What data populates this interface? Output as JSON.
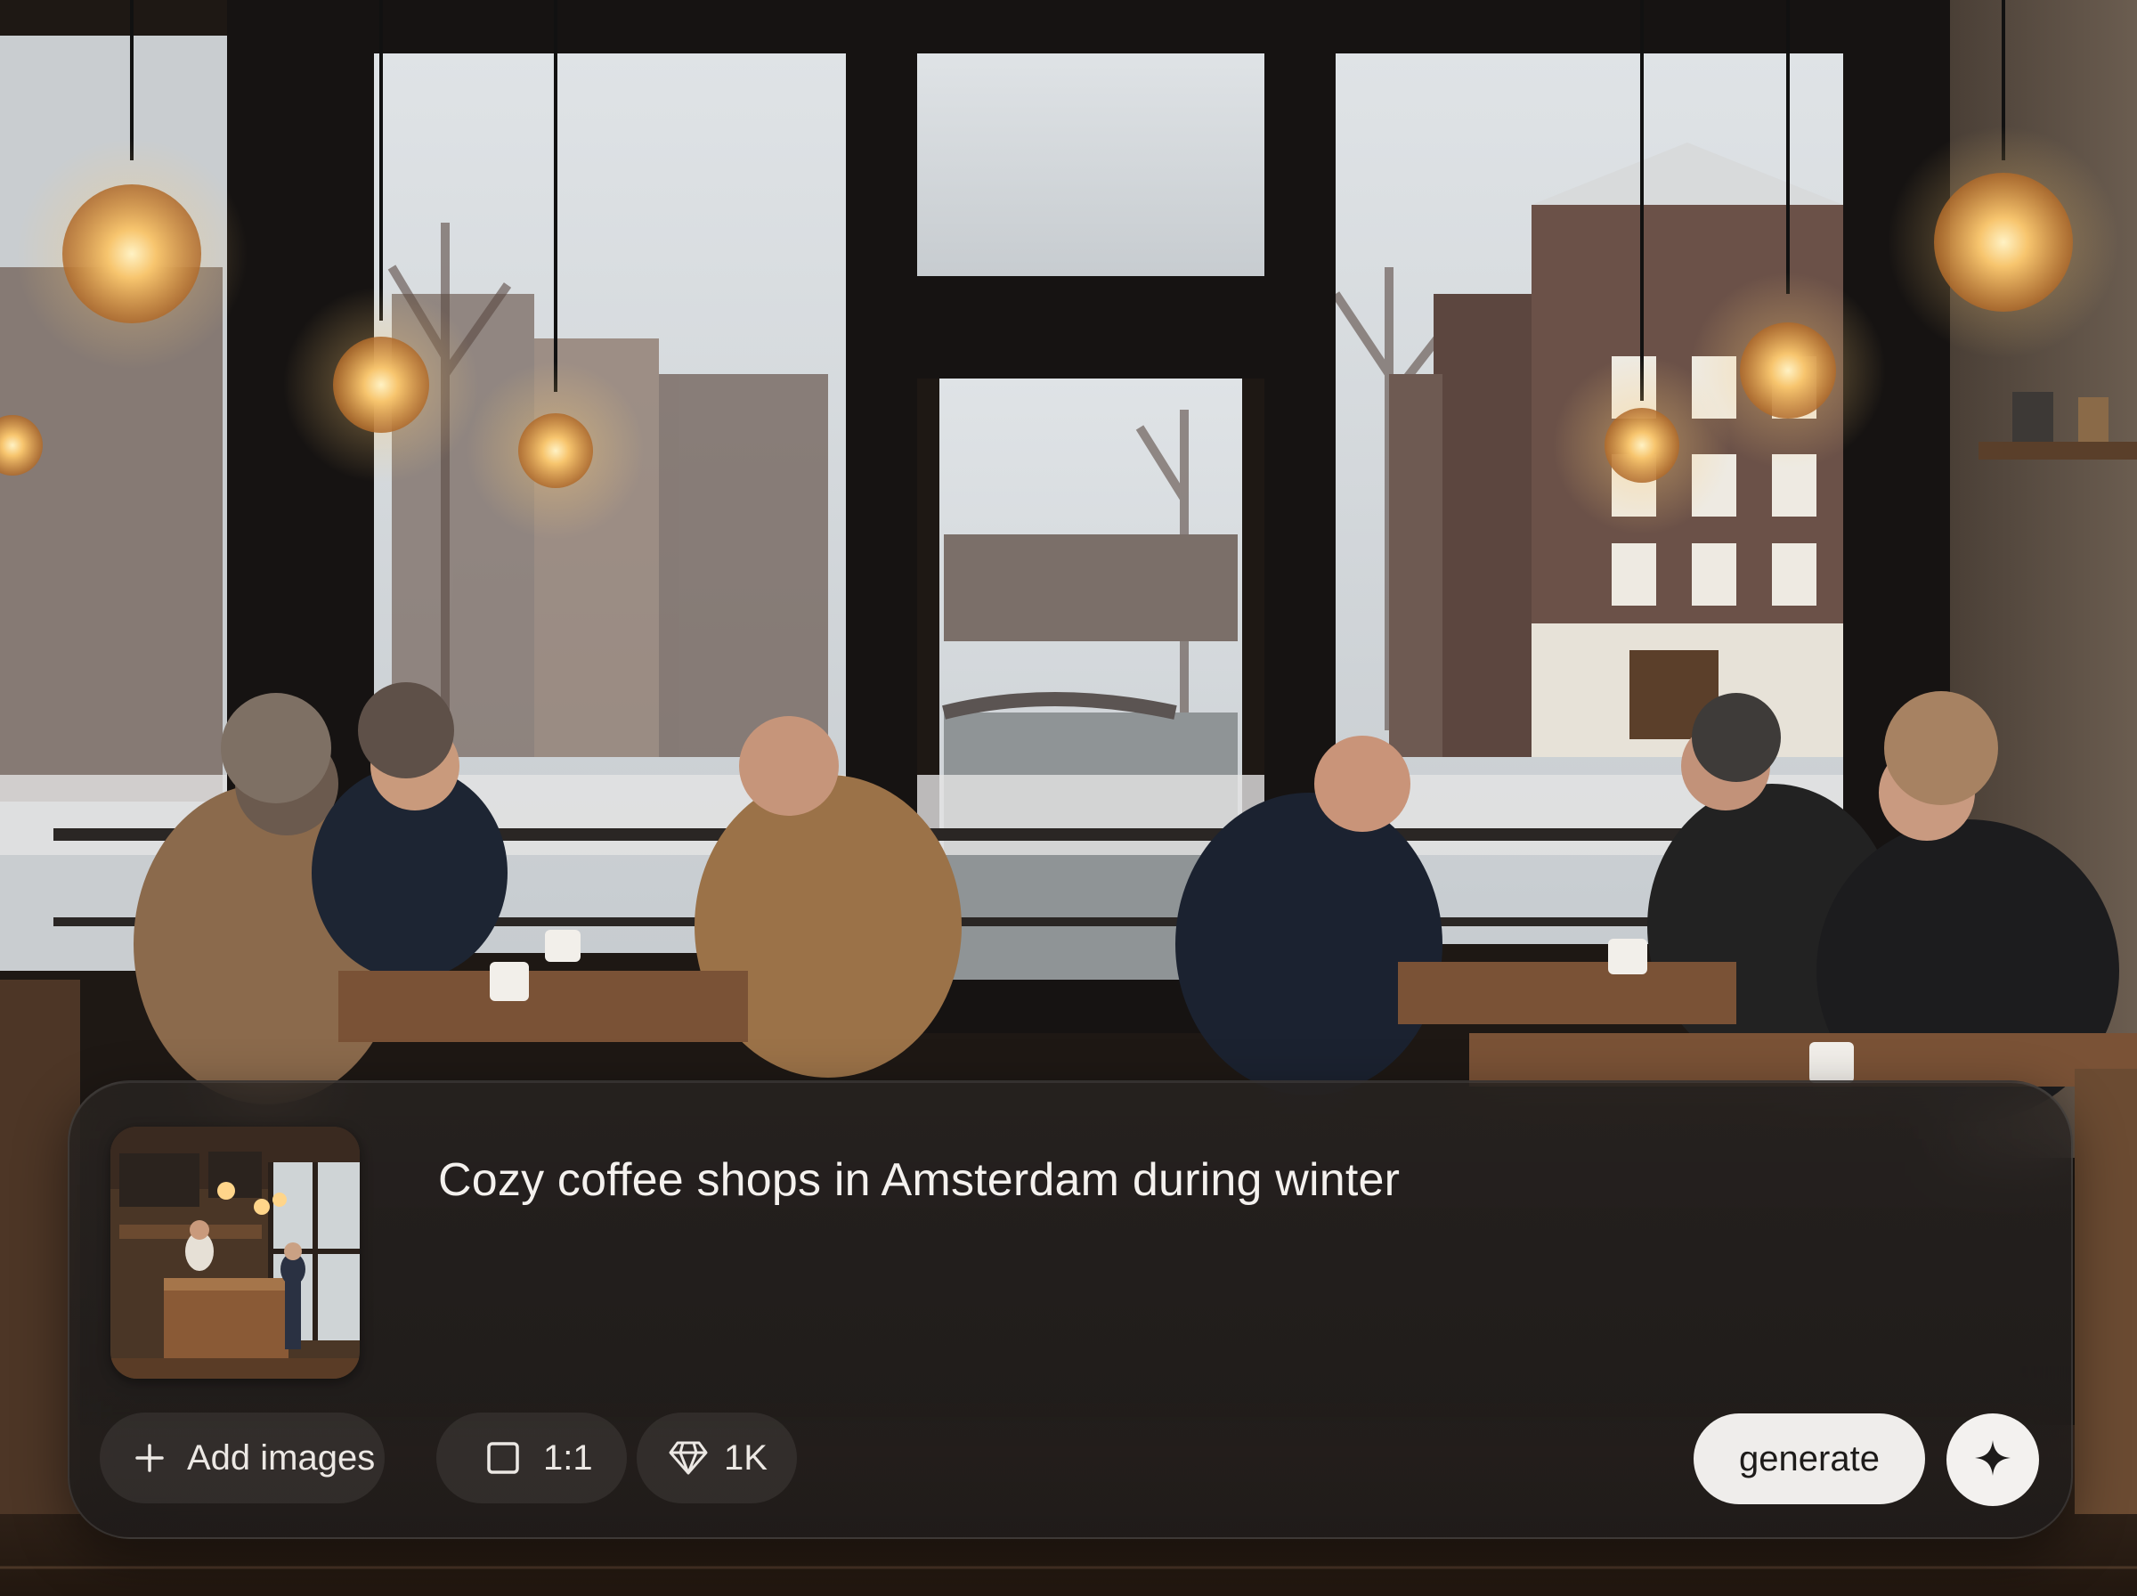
{
  "composer": {
    "prompt": "Cozy coffee shops in Amsterdam during winter",
    "reference_image": "coffee-shop-interior-thumbnail",
    "toolbar": {
      "add_images_label": "Add images",
      "aspect_ratio": "1:1",
      "resolution": "1K",
      "generate_label": "generate"
    },
    "icons": {
      "add": "plus-icon",
      "aspect": "square-icon",
      "resolution": "diamond-icon",
      "sparkle": "sparkle-icon"
    }
  },
  "colors": {
    "panel": "#28221f",
    "panel_text": "#f4f1ee",
    "pill_bg": "#3a3532",
    "button_bg": "#efedeb",
    "button_text": "#1d1b1a"
  }
}
